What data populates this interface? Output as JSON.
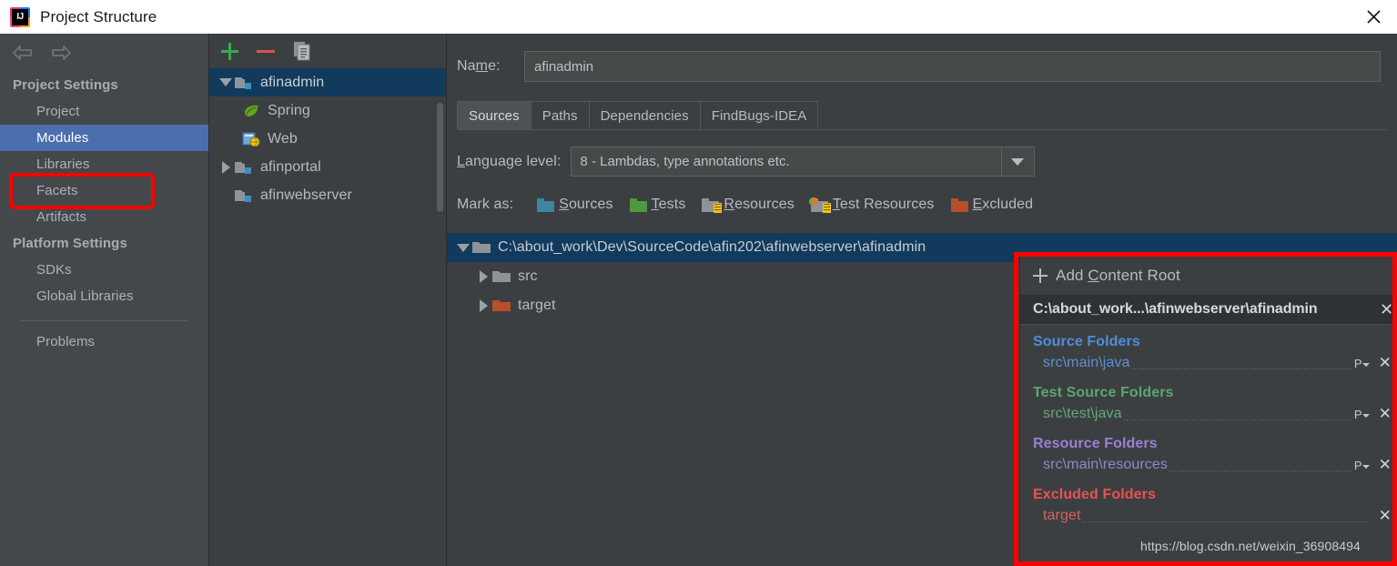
{
  "window": {
    "title": "Project Structure",
    "logo_text": "IJ",
    "close_icon": "close-icon"
  },
  "sidebar": {
    "nav": {
      "back_icon": "back-arrow-icon",
      "forward_icon": "forward-arrow-icon"
    },
    "sections": [
      {
        "label": "Project Settings",
        "items": [
          {
            "label": "Project",
            "selected": false
          },
          {
            "label": "Modules",
            "selected": true
          },
          {
            "label": "Libraries",
            "selected": false
          },
          {
            "label": "Facets",
            "selected": false
          },
          {
            "label": "Artifacts",
            "selected": false
          }
        ]
      },
      {
        "label": "Platform Settings",
        "items": [
          {
            "label": "SDKs",
            "selected": false
          },
          {
            "label": "Global Libraries",
            "selected": false
          }
        ]
      }
    ],
    "problems_label": "Problems"
  },
  "module_panel": {
    "toolbar": {
      "add_icon": "plus-icon",
      "remove_icon": "minus-icon",
      "copy_icon": "copy-icon"
    },
    "tree": [
      {
        "label": "afinadmin",
        "icon": "module-folder-icon",
        "expander": "down",
        "depth": 0,
        "selected": true
      },
      {
        "label": "Spring",
        "icon": "spring-leaf-icon",
        "expander": "none",
        "depth": 1,
        "selected": false
      },
      {
        "label": "Web",
        "icon": "web-facet-icon",
        "expander": "none",
        "depth": 1,
        "selected": false
      },
      {
        "label": "afinportal",
        "icon": "module-folder-icon",
        "expander": "right",
        "depth": 0,
        "selected": false
      },
      {
        "label": "afinwebserver",
        "icon": "module-folder-icon",
        "expander": "none",
        "depth": 0,
        "selected": false
      }
    ]
  },
  "content": {
    "name_label": "Name:",
    "name_value": "afinadmin",
    "tabs": [
      {
        "label": "Sources",
        "active": true
      },
      {
        "label": "Paths",
        "active": false
      },
      {
        "label": "Dependencies",
        "active": false
      },
      {
        "label": "FindBugs-IDEA",
        "active": false
      }
    ],
    "language_level_label": "Language level:",
    "language_level_value": "8 - Lambdas, type annotations etc.",
    "mark_as_label": "Mark as:",
    "mark_options": [
      {
        "label": "Sources",
        "mnemonic": "S",
        "rest": "ources",
        "icon": "sources-folder-icon",
        "color": "#3e86a0"
      },
      {
        "label": "Tests",
        "mnemonic": "T",
        "rest": "ests",
        "icon": "tests-folder-icon",
        "color": "#4e9a3f"
      },
      {
        "label": "Resources",
        "mnemonic": "R",
        "rest": "esources",
        "icon": "resources-folder-icon",
        "color": "#8d9499"
      },
      {
        "label": "Test Resources",
        "mnemonic": "T",
        "rest": "est Resources",
        "icon": "test-resources-folder-icon",
        "color": "#8d9499"
      },
      {
        "label": "Excluded",
        "mnemonic": "E",
        "rest": "xcluded",
        "icon": "excluded-folder-icon",
        "color": "#b7502a"
      }
    ],
    "root_tree": [
      {
        "label": "C:\\about_work\\Dev\\SourceCode\\afin202\\afinwebserver\\afinadmin",
        "expander": "down",
        "icon": "content-root-folder-icon",
        "color": "#8d9499",
        "depth": 0,
        "selected": true
      },
      {
        "label": "src",
        "expander": "right",
        "icon": "folder-icon",
        "color": "#8d9499",
        "depth": 1,
        "selected": false
      },
      {
        "label": "target",
        "expander": "right",
        "icon": "excluded-folder-icon",
        "color": "#b7502a",
        "depth": 1,
        "selected": false
      }
    ]
  },
  "roots_panel": {
    "add_content_root": {
      "label_prefix": "Add ",
      "mnemonic": "C",
      "label_suffix": "ontent Root",
      "icon": "plus-icon"
    },
    "selected_root": {
      "path": "C:\\about_work...\\afinwebserver\\afinadmin",
      "remove_icon": "close-icon"
    },
    "groups": [
      {
        "name": "source-folders",
        "header": "Source Folders",
        "items": [
          {
            "path": "src\\main\\java",
            "package_prefix_icon": "package-prefix-icon",
            "remove_icon": "close-icon"
          }
        ]
      },
      {
        "name": "test-source-folders",
        "header": "Test Source Folders",
        "items": [
          {
            "path": "src\\test\\java",
            "package_prefix_icon": "package-prefix-icon",
            "remove_icon": "close-icon"
          }
        ]
      },
      {
        "name": "resource-folders",
        "header": "Resource Folders",
        "items": [
          {
            "path": "src\\main\\resources",
            "package_prefix_icon": "package-prefix-icon",
            "remove_icon": "close-icon"
          }
        ]
      },
      {
        "name": "excluded-folders",
        "header": "Excluded Folders",
        "items": [
          {
            "path": "target",
            "package_prefix_icon": "",
            "remove_icon": "close-icon"
          }
        ]
      }
    ]
  },
  "watermark": "https://blog.csdn.net/weixin_36908494",
  "colors": {
    "highlight_box": "#fe0000",
    "selection_blue": "#4b6eaf",
    "tree_selection": "#113a5c",
    "source": "#4f8ddb",
    "test": "#5aa86f",
    "resource": "#9b7fd4",
    "excluded": "#e8534f"
  }
}
